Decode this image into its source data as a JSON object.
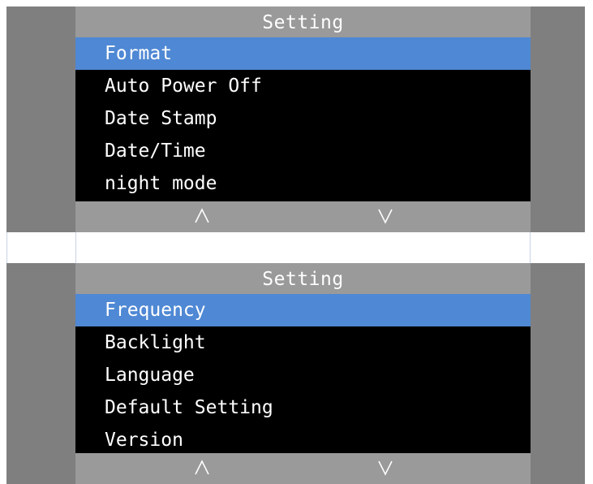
{
  "screens": [
    {
      "title": "Setting",
      "items": [
        {
          "label": "Format",
          "selected": true
        },
        {
          "label": "Auto Power Off",
          "selected": false
        },
        {
          "label": "Date Stamp",
          "selected": false
        },
        {
          "label": "Date/Time",
          "selected": false
        },
        {
          "label": "night mode",
          "selected": false
        }
      ],
      "nav": {
        "up_icon": "chevron-up-icon",
        "down_icon": "chevron-down-icon"
      }
    },
    {
      "title": "Setting",
      "items": [
        {
          "label": "Frequency",
          "selected": true
        },
        {
          "label": "Backlight",
          "selected": false
        },
        {
          "label": "Language",
          "selected": false
        },
        {
          "label": "Default Setting",
          "selected": false
        },
        {
          "label": "Version",
          "selected": false
        }
      ],
      "nav": {
        "up_icon": "chevron-up-icon",
        "down_icon": "chevron-down-icon"
      }
    }
  ],
  "colors": {
    "screen_background": "#000000",
    "bezel": "#7f7f7f",
    "bars": "#9a9a9a",
    "selection_highlight": "#4f88d4",
    "text": "#ffffff"
  }
}
